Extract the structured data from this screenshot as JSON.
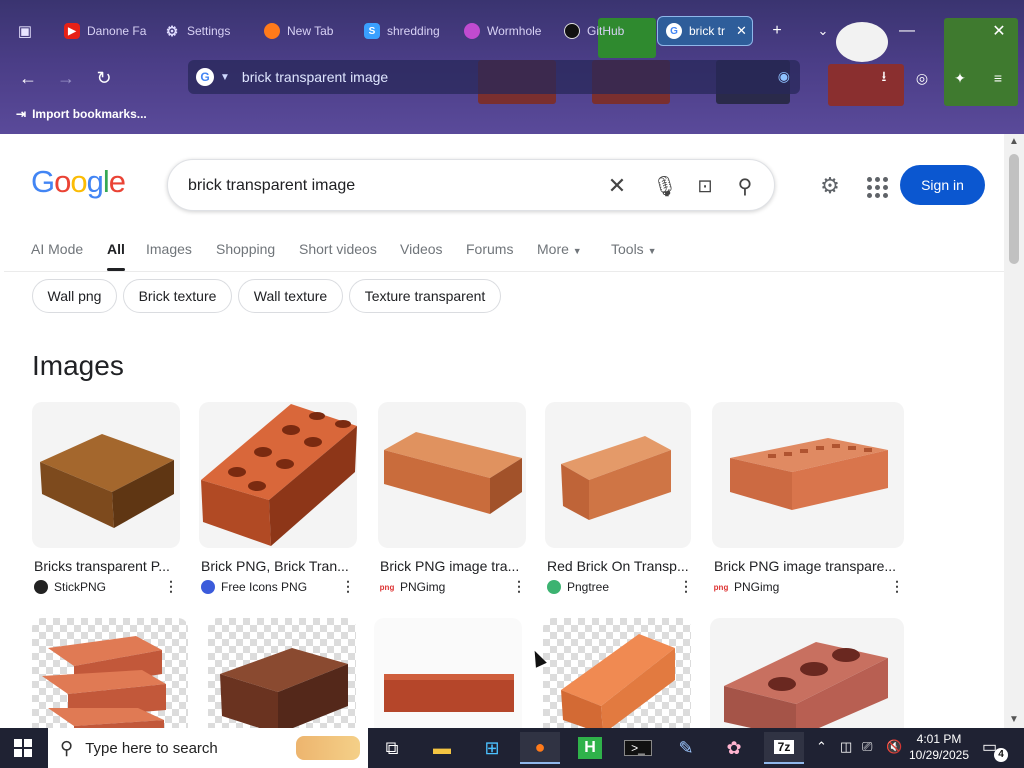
{
  "browser": {
    "tabs": [
      {
        "label": "Danone Fa",
        "icon": "youtube-icon"
      },
      {
        "label": "Settings",
        "icon": "gear-icon"
      },
      {
        "label": "New Tab",
        "icon": "firefox-icon"
      },
      {
        "label": "shredding",
        "icon": "s-icon"
      },
      {
        "label": "Wormhole",
        "icon": "wormhole-icon"
      },
      {
        "label": "GitHub",
        "icon": "github-icon"
      },
      {
        "label": "brick tr",
        "icon": "google-icon",
        "active": true
      }
    ],
    "url": "brick transparent image",
    "bookmarks": {
      "import_label": "Import bookmarks..."
    }
  },
  "google": {
    "logo": "Google",
    "query": "brick transparent image",
    "sign_in": "Sign in",
    "tabs": [
      "AI Mode",
      "All",
      "Images",
      "Shopping",
      "Short videos",
      "Videos",
      "Forums",
      "More",
      "Tools"
    ],
    "selected_tab": "All",
    "chips": [
      "Wall png",
      "Brick texture",
      "Wall texture",
      "Texture transparent"
    ],
    "images_heading": "Images",
    "results_row1": [
      {
        "caption": "Bricks transparent P...",
        "source": "StickPNG"
      },
      {
        "caption": "Brick PNG, Brick Tran...",
        "source": "Free Icons PNG"
      },
      {
        "caption": "Brick PNG image tra...",
        "source": "PNGimg"
      },
      {
        "caption": "Red Brick On Transp...",
        "source": "Pngtree"
      },
      {
        "caption": "Brick PNG image transpare...",
        "source": "PNGimg"
      }
    ]
  },
  "taskbar": {
    "search_placeholder": "Type here to search",
    "time": "4:01 PM",
    "date": "10/29/2025",
    "notifications": "4"
  },
  "colors": {
    "brand_blue": "#0b57d0",
    "brick": "#c4532f"
  }
}
